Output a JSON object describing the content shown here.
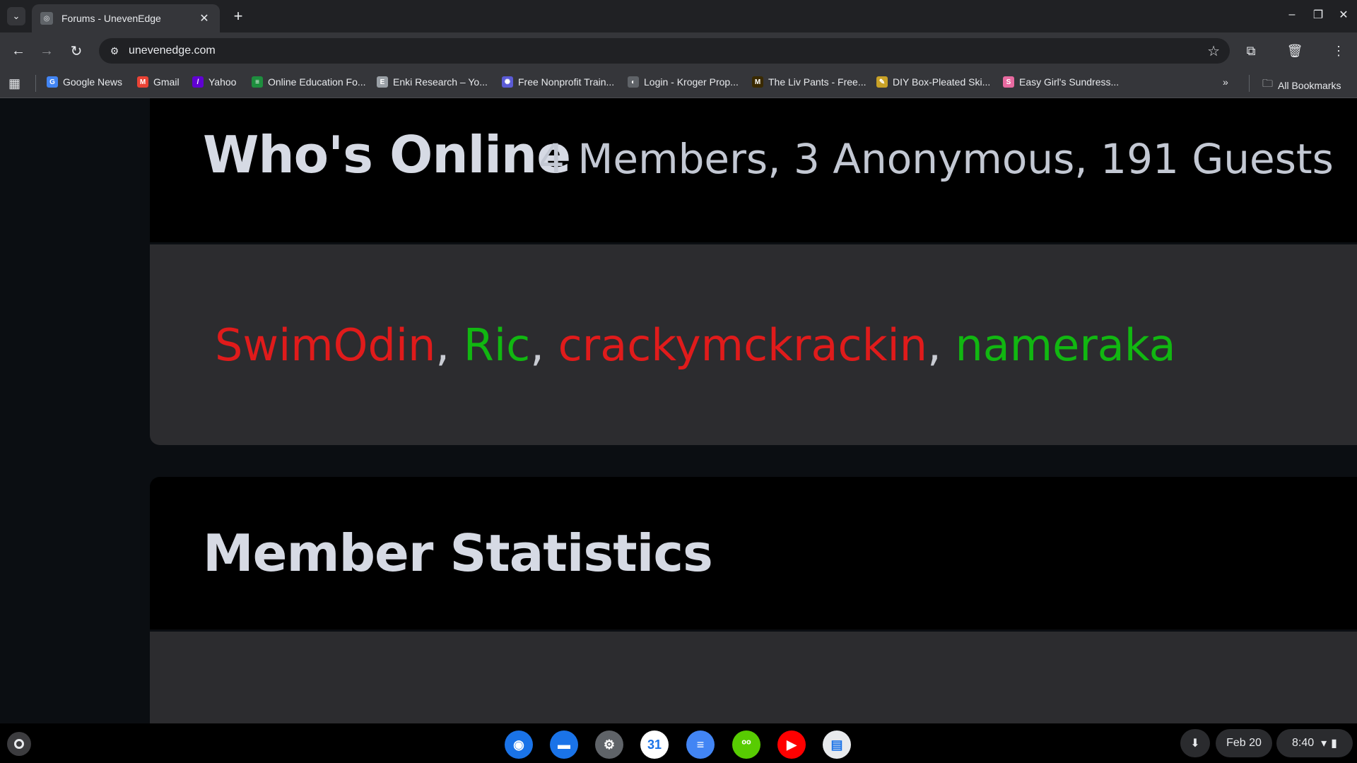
{
  "browser": {
    "tab_title": "Forums - UnevenEdge",
    "url": "unevenedge.com",
    "bookmarks": [
      {
        "label": "Google News",
        "icon": "google-news-icon",
        "color": "#4285f4",
        "glyph": "G"
      },
      {
        "label": "Gmail",
        "icon": "gmail-icon",
        "color": "#ea4335",
        "glyph": "M"
      },
      {
        "label": "Yahoo",
        "icon": "yahoo-icon",
        "color": "#6001d2",
        "glyph": "/"
      },
      {
        "label": "Online Education Fo...",
        "icon": "education-icon",
        "color": "#1e8e3e",
        "glyph": "≡"
      },
      {
        "label": "Enki Research – Yo...",
        "icon": "enki-icon",
        "color": "#9aa0a6",
        "glyph": "E"
      },
      {
        "label": "Free Nonprofit Train...",
        "icon": "nonprofit-icon",
        "color": "#5b5bd6",
        "glyph": "✺"
      },
      {
        "label": "Login - Kroger Prop...",
        "icon": "kroger-icon",
        "color": "#5f6368",
        "glyph": "◐"
      },
      {
        "label": "The Liv Pants - Free...",
        "icon": "liv-pants-icon",
        "color": "#3a2a00",
        "glyph": "M"
      },
      {
        "label": "DIY Box-Pleated Ski...",
        "icon": "diy-icon",
        "color": "#c9a227",
        "glyph": "✎"
      },
      {
        "label": "Easy Girl's Sundress...",
        "icon": "sundress-icon",
        "color": "#e86aa0",
        "glyph": "S"
      }
    ],
    "all_bookmarks": "All Bookmarks"
  },
  "whos_online": {
    "title": "Who's Online",
    "summary": "4 Members, 3 Anonymous, 191 Guests",
    "members": [
      {
        "name": "SwimOdin",
        "color": "#e01b1b"
      },
      {
        "name": "Ric",
        "color": "#11b711"
      },
      {
        "name": "crackymckrackin",
        "color": "#e01b1b"
      },
      {
        "name": "nameraka",
        "color": "#11b711"
      }
    ],
    "separator": ", "
  },
  "member_statistics": {
    "title": "Member Statistics"
  },
  "shelf": {
    "date": "Feb 20",
    "time": "8:40",
    "apps": [
      {
        "name": "chrome-icon",
        "color": "#1a73e8"
      },
      {
        "name": "files-icon",
        "color": "#1a73e8"
      },
      {
        "name": "settings-icon",
        "color": "#5f6368"
      },
      {
        "name": "calendar-icon",
        "color": "#ffffff"
      },
      {
        "name": "docs-icon",
        "color": "#4285f4"
      },
      {
        "name": "duolingo-icon",
        "color": "#58cc02"
      },
      {
        "name": "youtube-icon",
        "color": "#ff0000"
      },
      {
        "name": "gallery-icon",
        "color": "#e8eaed"
      }
    ]
  }
}
